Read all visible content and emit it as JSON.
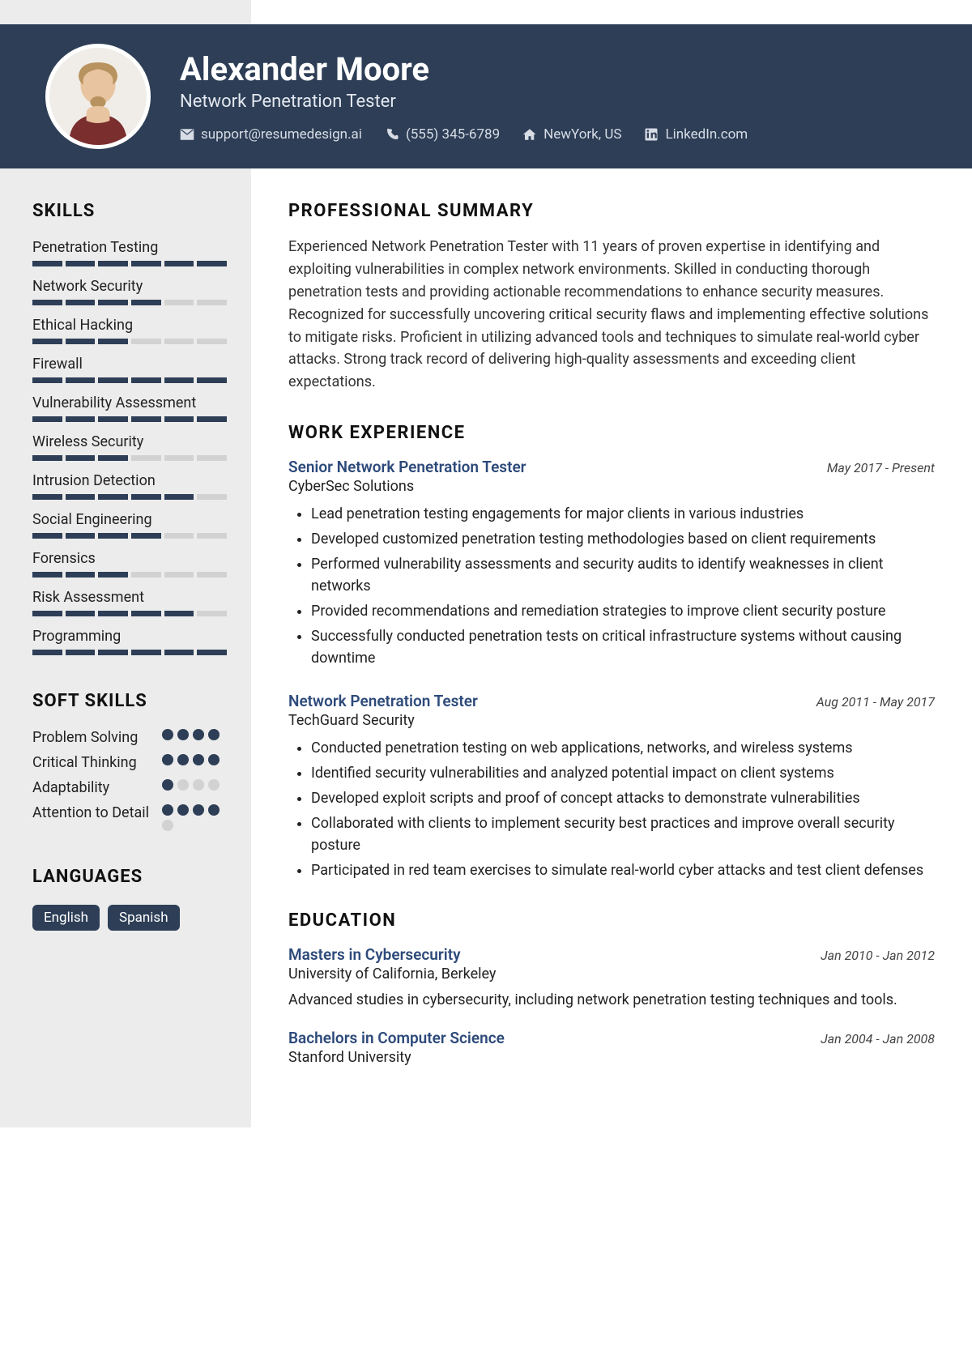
{
  "header": {
    "name": "Alexander Moore",
    "title": "Network Penetration Tester",
    "email": "support@resumedesign.ai",
    "phone": "(555) 345-6789",
    "location": "NewYork, US",
    "linkedin": "LinkedIn.com"
  },
  "sections": {
    "skills_head": "SKILLS",
    "soft_head": "SOFT SKILLS",
    "lang_head": "LANGUAGES",
    "summary_head": "PROFESSIONAL SUMMARY",
    "work_head": "WORK EXPERIENCE",
    "edu_head": "EDUCATION"
  },
  "skills": [
    {
      "name": "Penetration Testing",
      "level": 6
    },
    {
      "name": "Network Security",
      "level": 4
    },
    {
      "name": "Ethical Hacking",
      "level": 3
    },
    {
      "name": "Firewall",
      "level": 6
    },
    {
      "name": "Vulnerability Assessment",
      "level": 6
    },
    {
      "name": "Wireless Security",
      "level": 3
    },
    {
      "name": "Intrusion Detection",
      "level": 5
    },
    {
      "name": "Social Engineering",
      "level": 4
    },
    {
      "name": "Forensics",
      "level": 3
    },
    {
      "name": "Risk Assessment",
      "level": 5
    },
    {
      "name": "Programming",
      "level": 6
    }
  ],
  "soft_skills": [
    {
      "name": "Problem Solving",
      "level": 4,
      "max": 4
    },
    {
      "name": "Critical Thinking",
      "level": 4,
      "max": 4
    },
    {
      "name": "Adaptability",
      "level": 1,
      "max": 4
    },
    {
      "name": "Attention to Detail",
      "level": 4,
      "max": 5
    }
  ],
  "languages": [
    "English",
    "Spanish"
  ],
  "summary": "Experienced Network Penetration Tester with 11 years of proven expertise in identifying and exploiting vulnerabilities in complex network environments. Skilled in conducting thorough penetration tests and providing actionable recommendations to enhance security measures. Recognized for successfully uncovering critical security flaws and implementing effective solutions to mitigate risks. Proficient in utilizing advanced tools and techniques to simulate real-world cyber attacks. Strong track record of delivering high-quality assessments and exceeding client expectations.",
  "jobs": [
    {
      "title": "Senior Network Penetration Tester",
      "dates": "May 2017 - Present",
      "company": "CyberSec Solutions",
      "bullets": [
        "Lead penetration testing engagements for major clients in various industries",
        "Developed customized penetration testing methodologies based on client requirements",
        "Performed vulnerability assessments and security audits to identify weaknesses in client networks",
        "Provided recommendations and remediation strategies to improve client security posture",
        "Successfully conducted penetration tests on critical infrastructure systems without causing downtime"
      ]
    },
    {
      "title": "Network Penetration Tester",
      "dates": "Aug 2011 - May 2017",
      "company": "TechGuard Security",
      "bullets": [
        "Conducted penetration testing on web applications, networks, and wireless systems",
        "Identified security vulnerabilities and analyzed potential impact on client systems",
        "Developed exploit scripts and proof of concept attacks to demonstrate vulnerabilities",
        "Collaborated with clients to implement security best practices and improve overall security posture",
        "Participated in red team exercises to simulate real-world cyber attacks and test client defenses"
      ]
    }
  ],
  "education": [
    {
      "title": "Masters in Cybersecurity",
      "dates": "Jan 2010 - Jan 2012",
      "school": "University of California, Berkeley",
      "desc": "Advanced studies in cybersecurity, including network penetration testing techniques and tools."
    },
    {
      "title": "Bachelors in Computer Science",
      "dates": "Jan 2004 - Jan 2008",
      "school": "Stanford University",
      "desc": ""
    }
  ]
}
